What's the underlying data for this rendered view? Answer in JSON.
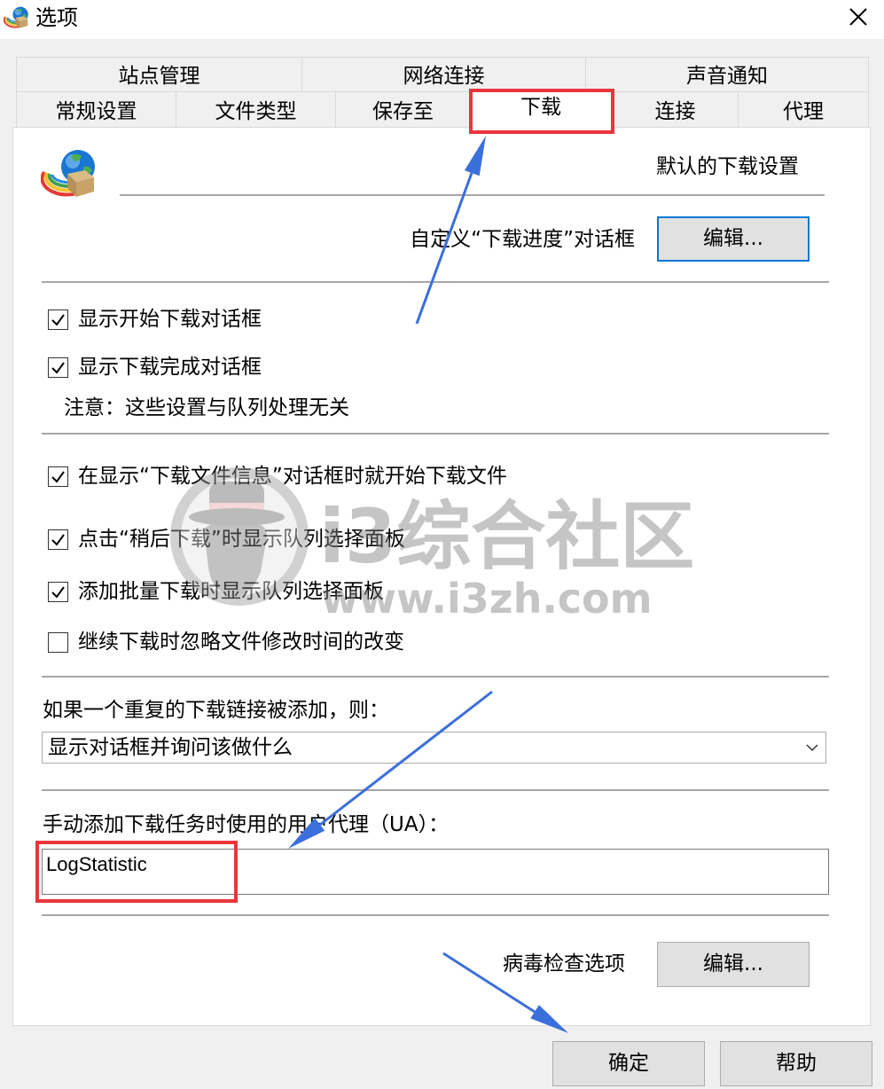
{
  "window": {
    "title": "选项"
  },
  "tabs": {
    "row1": [
      {
        "label": "站点管理"
      },
      {
        "label": "网络连接"
      },
      {
        "label": "声音通知"
      }
    ],
    "row2": [
      {
        "label": "常规设置"
      },
      {
        "label": "文件类型"
      },
      {
        "label": "保存至"
      },
      {
        "label": "下载",
        "selected": true
      },
      {
        "label": "连接"
      },
      {
        "label": "代理"
      }
    ]
  },
  "download_page": {
    "header_title": "默认的下载设置",
    "progress_dialog": {
      "label": "自定义“下载进度”对话框",
      "button_label": "编辑..."
    },
    "dialog_options": [
      {
        "label": "显示开始下载对话框",
        "checked": true
      },
      {
        "label": "显示下载完成对话框",
        "checked": true
      }
    ],
    "note": "注意：这些设置与队列处理无关",
    "behavior_options": [
      {
        "label": "在显示“下载文件信息”对话框时就开始下载文件",
        "checked": true
      },
      {
        "label": "点击“稍后下载”时显示队列选择面板",
        "checked": true
      },
      {
        "label": "添加批量下载时显示队列选择面板",
        "checked": true
      },
      {
        "label": "继续下载时忽略文件修改时间的改变",
        "checked": false
      }
    ],
    "duplicate_link": {
      "label": "如果一个重复的下载链接被添加，则：",
      "selected": "显示对话框并询问该做什么"
    },
    "user_agent": {
      "label": "手动添加下载任务时使用的用户代理（UA）：",
      "value": "LogStatistic"
    },
    "virus_check": {
      "label": "病毒检查选项",
      "button_label": "编辑..."
    }
  },
  "footer": {
    "ok_label": "确定",
    "help_label": "帮助"
  },
  "icons": {
    "app": "idm-globe-icon",
    "close": "close-icon",
    "dropdown": "chevron-down-icon",
    "check": "checkmark-icon"
  },
  "annotations": {
    "highlight_color": "#e8363c",
    "arrow_color": "#3b6fdc"
  },
  "watermark": {
    "brand": "i3综合社区",
    "site": "www.i3zh.com"
  },
  "colors": {
    "dialog_bg": "#f0f0f0",
    "button_bg": "#e1e1e1",
    "focus_border": "#0078d7"
  }
}
